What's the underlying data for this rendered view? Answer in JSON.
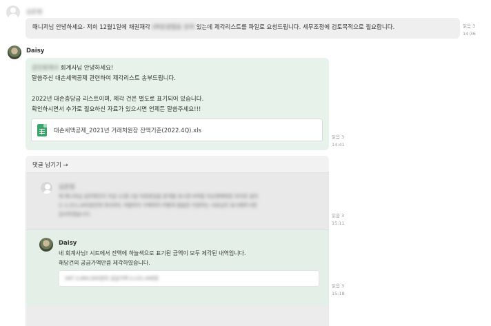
{
  "msg1": {
    "sender": "김은정",
    "text": "매니저님 안녕하세요- 저희 12월1일에 채권재각 (㈜한경협동 한꺼 있는데 제각리스트를 파일로 요청드립니다. 세무조정에 검토목적으로 필요합니다.",
    "text_a": "매니저님 안녕하세요- 저희 12월1일에 채권재각 ",
    "text_blur": "(㈜한경협동 한꺼",
    "text_b": " 있는데 제각리스트를 파일로 요청드립니다. 세무조정에 검토목적으로 필요합니다.",
    "read": "읽음 3",
    "time": "14:36"
  },
  "msg2": {
    "sender": "Daisy",
    "greeting_blur": "공인회계사",
    "greeting": " 회계사님 안녕하세요!",
    "line2": "말씀주신 대손세액공제 관련하여 제각리스트 송부드립니다.",
    "line3": "2022년 대손충당금 리스트이며, 제각 건은 별도로 표기되어 있습니다.",
    "line4": "확인하시면서 추가로 필요하신 자료가 있으시면 언제든 말씀주세요!!!",
    "file_name": "대손세액공제_2021년 거래처원장 잔액기준(2022.4Q).xls",
    "read": "읽음 3",
    "time": "14:41"
  },
  "thread": {
    "reply_link": "댓글 남기기 →",
    "reply1": {
      "sender": "김은정",
      "line1": "제 매니저님 실무확인이 지금 12월 1일 자료분입을 분개를 표시한 6억월 지상경매와원 차이로 설치",
      "line2": "드 2,311,445원인데 회사부도 처럼하지 가제하려 어떻게 말씀한 지원하는 사유님이 표시해주시면",
      "line3": "감사하겠습니다.",
      "read": "읽음 3",
      "time": "15:11"
    },
    "reply2": {
      "sender": "Daisy",
      "line1": "네 회계사님! 시트에서 잔액에 하늘색으로 표기된 금액이 모두 제각된 내역입니다.",
      "line2": "해당건의 공급가액만큼 제각하였습니다.",
      "card_blur": "VAT 3,464,000원의 공급가액 3,131,446원",
      "read": "읽음 3",
      "time": "15:18"
    }
  }
}
